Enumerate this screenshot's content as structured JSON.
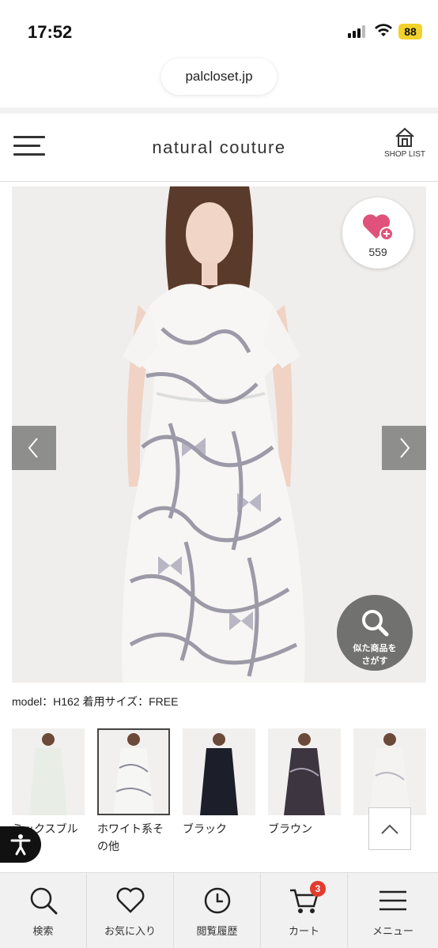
{
  "status_bar": {
    "time": "17:52",
    "battery": "88"
  },
  "browser": {
    "url": "palcloset.jp"
  },
  "header": {
    "brand": "natural couture",
    "shop_list_label": "SHOP LIST"
  },
  "product": {
    "favorite_count": "559",
    "similar_label_line1": "似た商品を",
    "similar_label_line2": "さがす",
    "model_info": "model：H162 着用サイズ：FREE"
  },
  "colors": [
    {
      "label": "ミックスブル",
      "icon": "mint-dress-photo"
    },
    {
      "label": "ホワイト系その他",
      "icon": "white-ribbon-dress-photo",
      "selected": true
    },
    {
      "label": "ブラック",
      "icon": "black-dress-photo"
    },
    {
      "label": "ブラウン",
      "icon": "brown-dress-photo"
    },
    {
      "label": "",
      "icon": "white-dress-photo"
    }
  ],
  "bottom_nav": [
    {
      "label": "検索",
      "icon": "search-icon"
    },
    {
      "label": "お気に入り",
      "icon": "heart-icon"
    },
    {
      "label": "閲覧履歴",
      "icon": "clock-icon"
    },
    {
      "label": "カート",
      "icon": "cart-icon",
      "badge": "3"
    },
    {
      "label": "メニュー",
      "icon": "menu-icon"
    }
  ],
  "theme": {
    "heart_color": "#e0527a",
    "cart_badge_color": "#e23b2e",
    "hero_bg": "#e8e6e4"
  }
}
